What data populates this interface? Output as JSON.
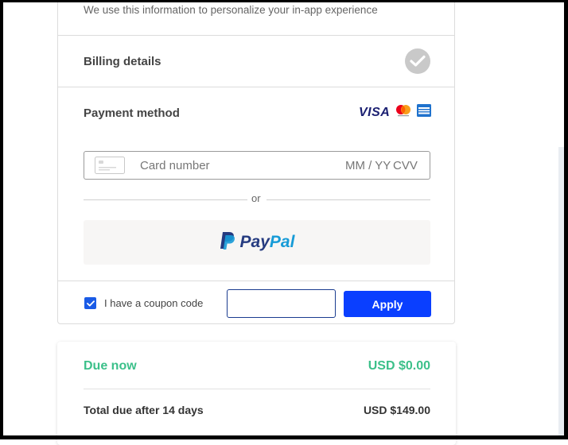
{
  "profile": {
    "info_text": "We use this information to personalize your in-app experience"
  },
  "billing": {
    "title": "Billing details",
    "status_icon": "check-circle-icon",
    "status_color": "#c9c9c9"
  },
  "payment": {
    "title": "Payment method",
    "brands": {
      "visa": "VISA",
      "mastercard_icon": "mastercard-icon",
      "amex_icon": "amex-icon"
    },
    "card_number_placeholder": "Card number",
    "expiry_placeholder": "MM / YY",
    "cvv_placeholder": "CVV",
    "or_label": "or",
    "paypal": {
      "pay": "Pay",
      "pal": "Pal",
      "pay_color": "#253b80",
      "pal_color": "#179bd7"
    }
  },
  "coupon": {
    "checked": true,
    "label": "I have a coupon code",
    "input_value": "",
    "apply_label": "Apply",
    "accent": "#0a3fff"
  },
  "summary": {
    "due_now_label": "Due now",
    "due_now_amount": "USD $0.00",
    "total_label": "Total due after 14 days",
    "total_amount": "USD $149.00",
    "due_color": "#3cc08a"
  }
}
